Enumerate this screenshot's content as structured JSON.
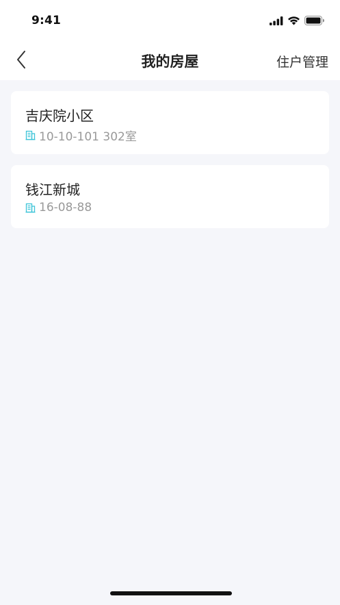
{
  "status_bar": {
    "time": "9:41",
    "icons": [
      "signal-icon",
      "wifi-icon",
      "battery-icon"
    ]
  },
  "nav": {
    "back_icon": "chevron-left-icon",
    "title": "我的房屋",
    "action_label": "住户管理"
  },
  "houses": [
    {
      "name": "吉庆院小区",
      "address": "10-10-101 302室",
      "icon": "building-icon"
    },
    {
      "name": "钱江新城",
      "address": "16-08-88",
      "icon": "building-icon"
    }
  ],
  "colors": {
    "background": "#F5F6FA",
    "card": "#FFFFFF",
    "accent_icon": "#3CC4D8",
    "title_text": "#222222",
    "secondary_text": "#999999"
  }
}
